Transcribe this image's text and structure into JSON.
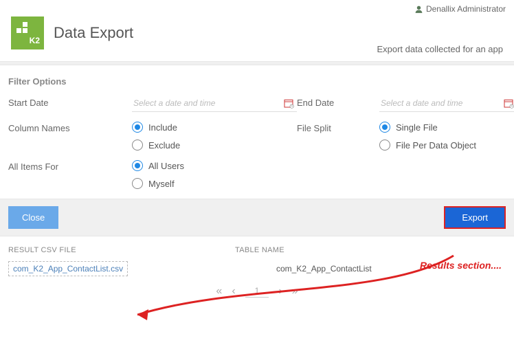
{
  "user": {
    "name": "Denallix Administrator"
  },
  "header": {
    "logo_text": "K2",
    "title": "Data Export",
    "subtitle": "Export data collected for an app"
  },
  "filter": {
    "section_title": "Filter Options",
    "start_date": {
      "label": "Start Date",
      "placeholder": "Select a date and time"
    },
    "end_date": {
      "label": "End Date",
      "placeholder": "Select a date and time"
    },
    "column_names": {
      "label": "Column Names",
      "options": [
        "Include",
        "Exclude"
      ],
      "selected": "Include"
    },
    "file_split": {
      "label": "File Split",
      "options": [
        "Single File",
        "File Per Data Object"
      ],
      "selected": "Single File"
    },
    "all_items_for": {
      "label": "All Items For",
      "options": [
        "All Users",
        "Myself"
      ],
      "selected": "All Users"
    }
  },
  "actions": {
    "close": "Close",
    "export": "Export"
  },
  "results": {
    "col_file": "RESULT CSV FILE",
    "col_table": "TABLE NAME",
    "rows": [
      {
        "file": "com_K2_App_ContactList.csv",
        "table": "com_K2_App_ContactList"
      }
    ],
    "page": "1",
    "annotation": "Results section...."
  }
}
